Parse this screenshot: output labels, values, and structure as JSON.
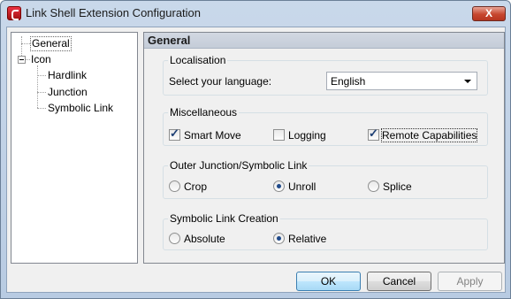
{
  "window": {
    "title": "Link Shell Extension Configuration",
    "close_label": "X"
  },
  "tree": {
    "items": [
      {
        "label": "General",
        "selected": true
      },
      {
        "label": "Icon",
        "expanded": true
      },
      {
        "label": "Hardlink"
      },
      {
        "label": "Junction"
      },
      {
        "label": "Symbolic Link"
      }
    ]
  },
  "panel": {
    "title": "General",
    "localisation": {
      "group_label": "Localisation",
      "language_label": "Select your language:",
      "language_value": "English"
    },
    "misc": {
      "group_label": "Miscellaneous",
      "options": [
        {
          "label": "Smart Move",
          "checked": true
        },
        {
          "label": "Logging",
          "checked": false
        },
        {
          "label": "Remote Capabilities",
          "checked": true
        }
      ]
    },
    "outer_junction": {
      "group_label": "Outer Junction/Symbolic Link",
      "options": [
        {
          "label": "Crop",
          "selected": false
        },
        {
          "label": "Unroll",
          "selected": true
        },
        {
          "label": "Splice",
          "selected": false
        }
      ]
    },
    "symlink_creation": {
      "group_label": "Symbolic Link Creation",
      "options": [
        {
          "label": "Absolute",
          "selected": false
        },
        {
          "label": "Relative",
          "selected": true
        }
      ]
    }
  },
  "buttons": {
    "ok": "OK",
    "cancel": "Cancel",
    "apply": "Apply"
  }
}
